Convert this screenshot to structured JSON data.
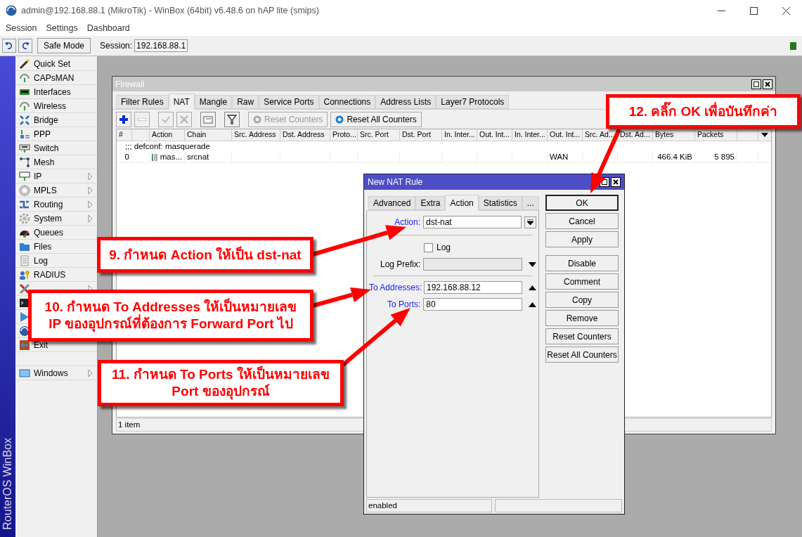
{
  "window": {
    "title": "admin@192.168.88.1 (MikroTik) - WinBox (64bit) v6.48.6 on hAP lite (smips)"
  },
  "menu": [
    "Session",
    "Settings",
    "Dashboard"
  ],
  "toolbar": {
    "safe_mode": "Safe Mode",
    "session_label": "Session:",
    "session_value": "192.168.88.1"
  },
  "sidebar": {
    "brand": "RouterOS WinBox",
    "items": [
      {
        "kind": "entry",
        "label": "Quick Set",
        "submenu": false
      },
      {
        "kind": "entry",
        "label": "CAPsMAN",
        "submenu": false
      },
      {
        "kind": "entry",
        "label": "Interfaces",
        "submenu": false
      },
      {
        "kind": "entry",
        "label": "Wireless",
        "submenu": false
      },
      {
        "kind": "entry",
        "label": "Bridge",
        "submenu": false
      },
      {
        "kind": "entry",
        "label": "PPP",
        "submenu": false
      },
      {
        "kind": "entry",
        "label": "Switch",
        "submenu": false
      },
      {
        "kind": "entry",
        "label": "Mesh",
        "submenu": false
      },
      {
        "kind": "entry",
        "label": "IP",
        "submenu": true
      },
      {
        "kind": "entry",
        "label": "MPLS",
        "submenu": true
      },
      {
        "kind": "entry",
        "label": "Routing",
        "submenu": true
      },
      {
        "kind": "entry",
        "label": "System",
        "submenu": true
      },
      {
        "kind": "entry",
        "label": "Queues",
        "submenu": false
      },
      {
        "kind": "entry",
        "label": "Files",
        "submenu": false
      },
      {
        "kind": "entry",
        "label": "Log",
        "submenu": false
      },
      {
        "kind": "entry",
        "label": "RADIUS",
        "submenu": false
      },
      {
        "kind": "entry",
        "submenu": true
      },
      {
        "kind": "covered"
      },
      {
        "kind": "covered"
      },
      {
        "kind": "covered"
      },
      {
        "kind": "entry",
        "label": "Exit",
        "submenu": false
      }
    ],
    "bottom_items": [
      {
        "kind": "entry",
        "label": "Windows",
        "submenu": true
      }
    ]
  },
  "firewall": {
    "title": "Firewall",
    "tabs": [
      {
        "label": "Filter Rules",
        "selected": false
      },
      {
        "label": "NAT",
        "selected": true
      },
      {
        "label": "Mangle",
        "selected": false
      },
      {
        "label": "Raw",
        "selected": false
      },
      {
        "label": "Service Ports",
        "selected": false
      },
      {
        "label": "Connections",
        "selected": false
      },
      {
        "label": "Address Lists",
        "selected": false
      },
      {
        "label": "Layer7 Protocols",
        "selected": false
      }
    ],
    "toolbar_buttons": [
      {
        "label": "Reset Counters",
        "disabled": true
      },
      {
        "label": "Reset All Counters",
        "disabled": false
      }
    ],
    "columns": [
      {
        "label": "#"
      },
      {},
      {
        "label": "Action"
      },
      {
        "label": "Chain"
      },
      {
        "label": "Src. Address"
      },
      {
        "label": "Dst. Address"
      },
      {
        "label": "Proto..."
      },
      {
        "label": "Src. Port"
      },
      {
        "label": "Dst. Port"
      },
      {
        "label": "In. Inter..."
      },
      {
        "label": "Out. Int..."
      },
      {
        "label": "In. Inter..."
      },
      {
        "label": "Out. Int..."
      },
      {
        "label": "Src. Ad..."
      },
      {
        "label": "Dst. Ad..."
      },
      {
        "label": "Bytes"
      },
      {
        "label": "Packets"
      },
      {}
    ],
    "rows": [
      {
        "comment": ";;; defconf: masquerade",
        "number": "0",
        "action": "mas...",
        "chain": "srcnat",
        "out_interface_list": "WAN",
        "bytes": "466.4 KiB",
        "packets": "5 895"
      }
    ],
    "status": "1 item"
  },
  "dialog": {
    "title": "New NAT Rule",
    "tabs": [
      {
        "label": "Advanced",
        "selected": false
      },
      {
        "label": "Extra",
        "selected": false
      },
      {
        "label": "Action",
        "selected": true
      },
      {
        "label": "Statistics",
        "selected": false
      },
      {
        "label": "...",
        "selected": false
      }
    ],
    "action": {
      "label": "Action:",
      "value": "dst-nat",
      "set": true
    },
    "log": {
      "label": "Log",
      "checked": false
    },
    "log_prefix": {
      "label": "Log Prefix:",
      "set": false
    },
    "to_addresses": {
      "label": "To Addresses:",
      "value": "192.168.88.12",
      "set": true
    },
    "to_ports": {
      "label": "To Ports:",
      "value": "80",
      "set": true
    },
    "buttons": [
      {
        "label": "OK",
        "default": true
      },
      {
        "label": "Cancel",
        "default": false
      },
      {
        "label": "Apply",
        "default": false
      },
      {
        "label": "Disable",
        "default": false
      },
      {
        "label": "Comment",
        "default": false
      },
      {
        "label": "Copy",
        "default": false
      },
      {
        "label": "Remove",
        "default": false
      },
      {
        "label": "Reset Counters",
        "default": false
      },
      {
        "label": "Reset All Counters",
        "default": false
      }
    ],
    "status": "enabled"
  },
  "callouts": [
    {
      "lines": [
        "9. กำหนด Action ให้เป็น dst-nat"
      ]
    },
    {
      "lines": [
        "10. กำหนด To Addresses ให้เป็นหมายเลข",
        "IP ของอุปกรณ์ที่ต้องการ Forward Port ไป"
      ]
    },
    {
      "lines": [
        "11. กำหนด To Ports ให้เป็นหมายเลข",
        "Port ของอุปกรณ์"
      ]
    },
    {
      "lines": [
        "12. คลิ๊ก OK เพื่อบันทึกค่า"
      ]
    }
  ]
}
